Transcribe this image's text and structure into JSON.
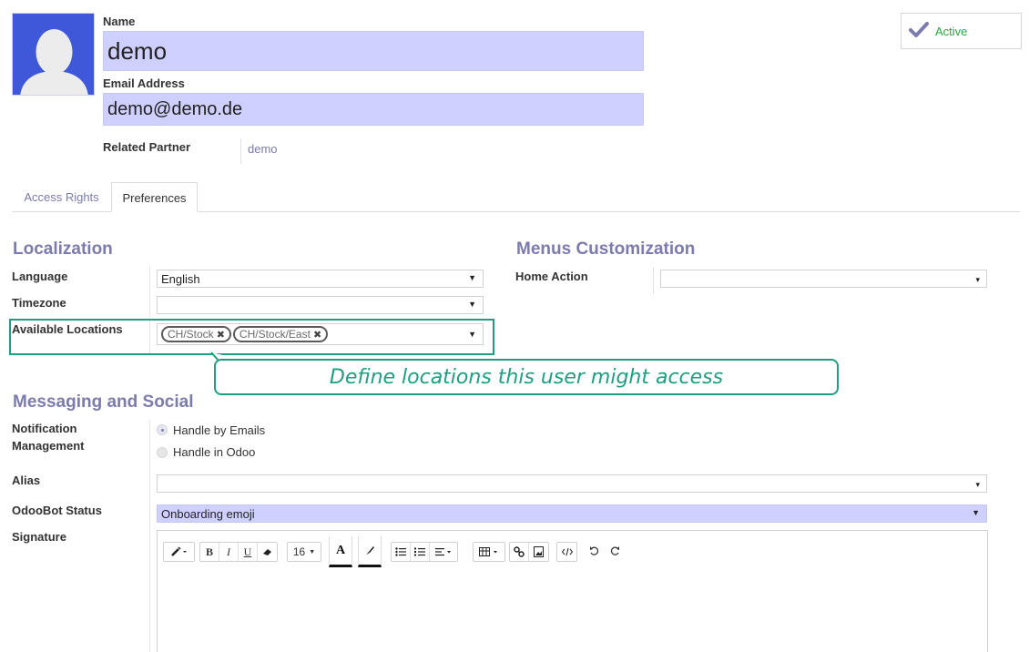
{
  "user": {
    "name_label": "Name",
    "name_value": "demo",
    "email_label": "Email Address",
    "email_value": "demo@demo.de",
    "related_partner_label": "Related Partner",
    "related_partner_value": "demo"
  },
  "status_button": {
    "label": "Active",
    "color": "#28a745"
  },
  "tabs": [
    {
      "label": "Access Rights",
      "active": false
    },
    {
      "label": "Preferences",
      "active": true
    }
  ],
  "localization": {
    "title": "Localization",
    "language_label": "Language",
    "language_value": "English",
    "timezone_label": "Timezone",
    "timezone_value": "",
    "locations_label": "Available Locations",
    "locations": [
      "CH/Stock",
      "CH/Stock/East"
    ]
  },
  "menus": {
    "title": "Menus Customization",
    "home_action_label": "Home Action",
    "home_action_value": ""
  },
  "callout": {
    "text": "Define locations this user might access",
    "color": "#1f9e82"
  },
  "messaging": {
    "title": "Messaging and Social",
    "notification_label_line1": "Notification",
    "notification_label_line2": "Management",
    "options": [
      "Handle by Emails",
      "Handle in Odoo"
    ],
    "selected_option": "Handle by Emails",
    "alias_label": "Alias",
    "alias_value": "",
    "odoobot_label": "OdooBot Status",
    "odoobot_value": "Onboarding emoji",
    "signature_label": "Signature"
  },
  "editor_toolbar": {
    "font_size": "16",
    "bold": "B",
    "italic": "I",
    "underline": "U",
    "font_color": "A"
  },
  "colors": {
    "accent": "#7c7bad",
    "input_highlight": "#cfd0ff",
    "avatar_bg": "#3f58d9"
  }
}
